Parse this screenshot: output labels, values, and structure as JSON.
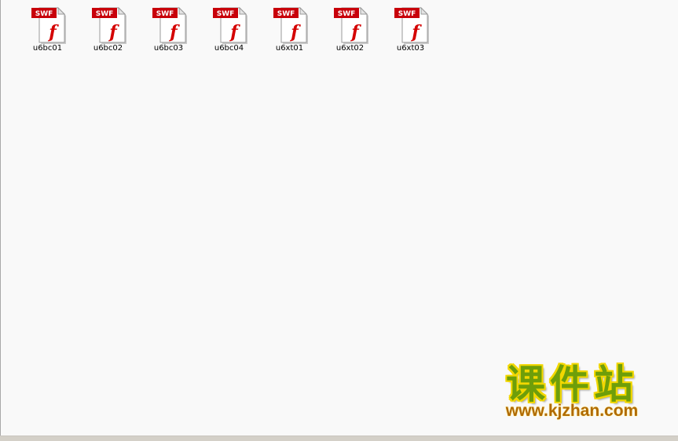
{
  "files": [
    {
      "name": "u6bc01",
      "badge": "SWF",
      "glyph": "f",
      "icon": "flash-swf-file-icon"
    },
    {
      "name": "u6bc02",
      "badge": "SWF",
      "glyph": "f",
      "icon": "flash-swf-file-icon"
    },
    {
      "name": "u6bc03",
      "badge": "SWF",
      "glyph": "f",
      "icon": "flash-swf-file-icon"
    },
    {
      "name": "u6bc04",
      "badge": "SWF",
      "glyph": "f",
      "icon": "flash-swf-file-icon"
    },
    {
      "name": "u6xt01",
      "badge": "SWF",
      "glyph": "f",
      "icon": "flash-swf-file-icon"
    },
    {
      "name": "u6xt02",
      "badge": "SWF",
      "glyph": "f",
      "icon": "flash-swf-file-icon"
    },
    {
      "name": "u6xt03",
      "badge": "SWF",
      "glyph": "f",
      "icon": "flash-swf-file-icon"
    }
  ],
  "watermark": {
    "title": "课件站",
    "url": "www.kjzhan.com"
  },
  "colors": {
    "pane_background": "#f9f9f9",
    "swf_badge_red": "#c8000a",
    "flash_glyph_red": "#d40000",
    "watermark_green": "#6e9e0a",
    "watermark_yellow": "#f2d700",
    "watermark_url_orange": "#b06a00"
  }
}
